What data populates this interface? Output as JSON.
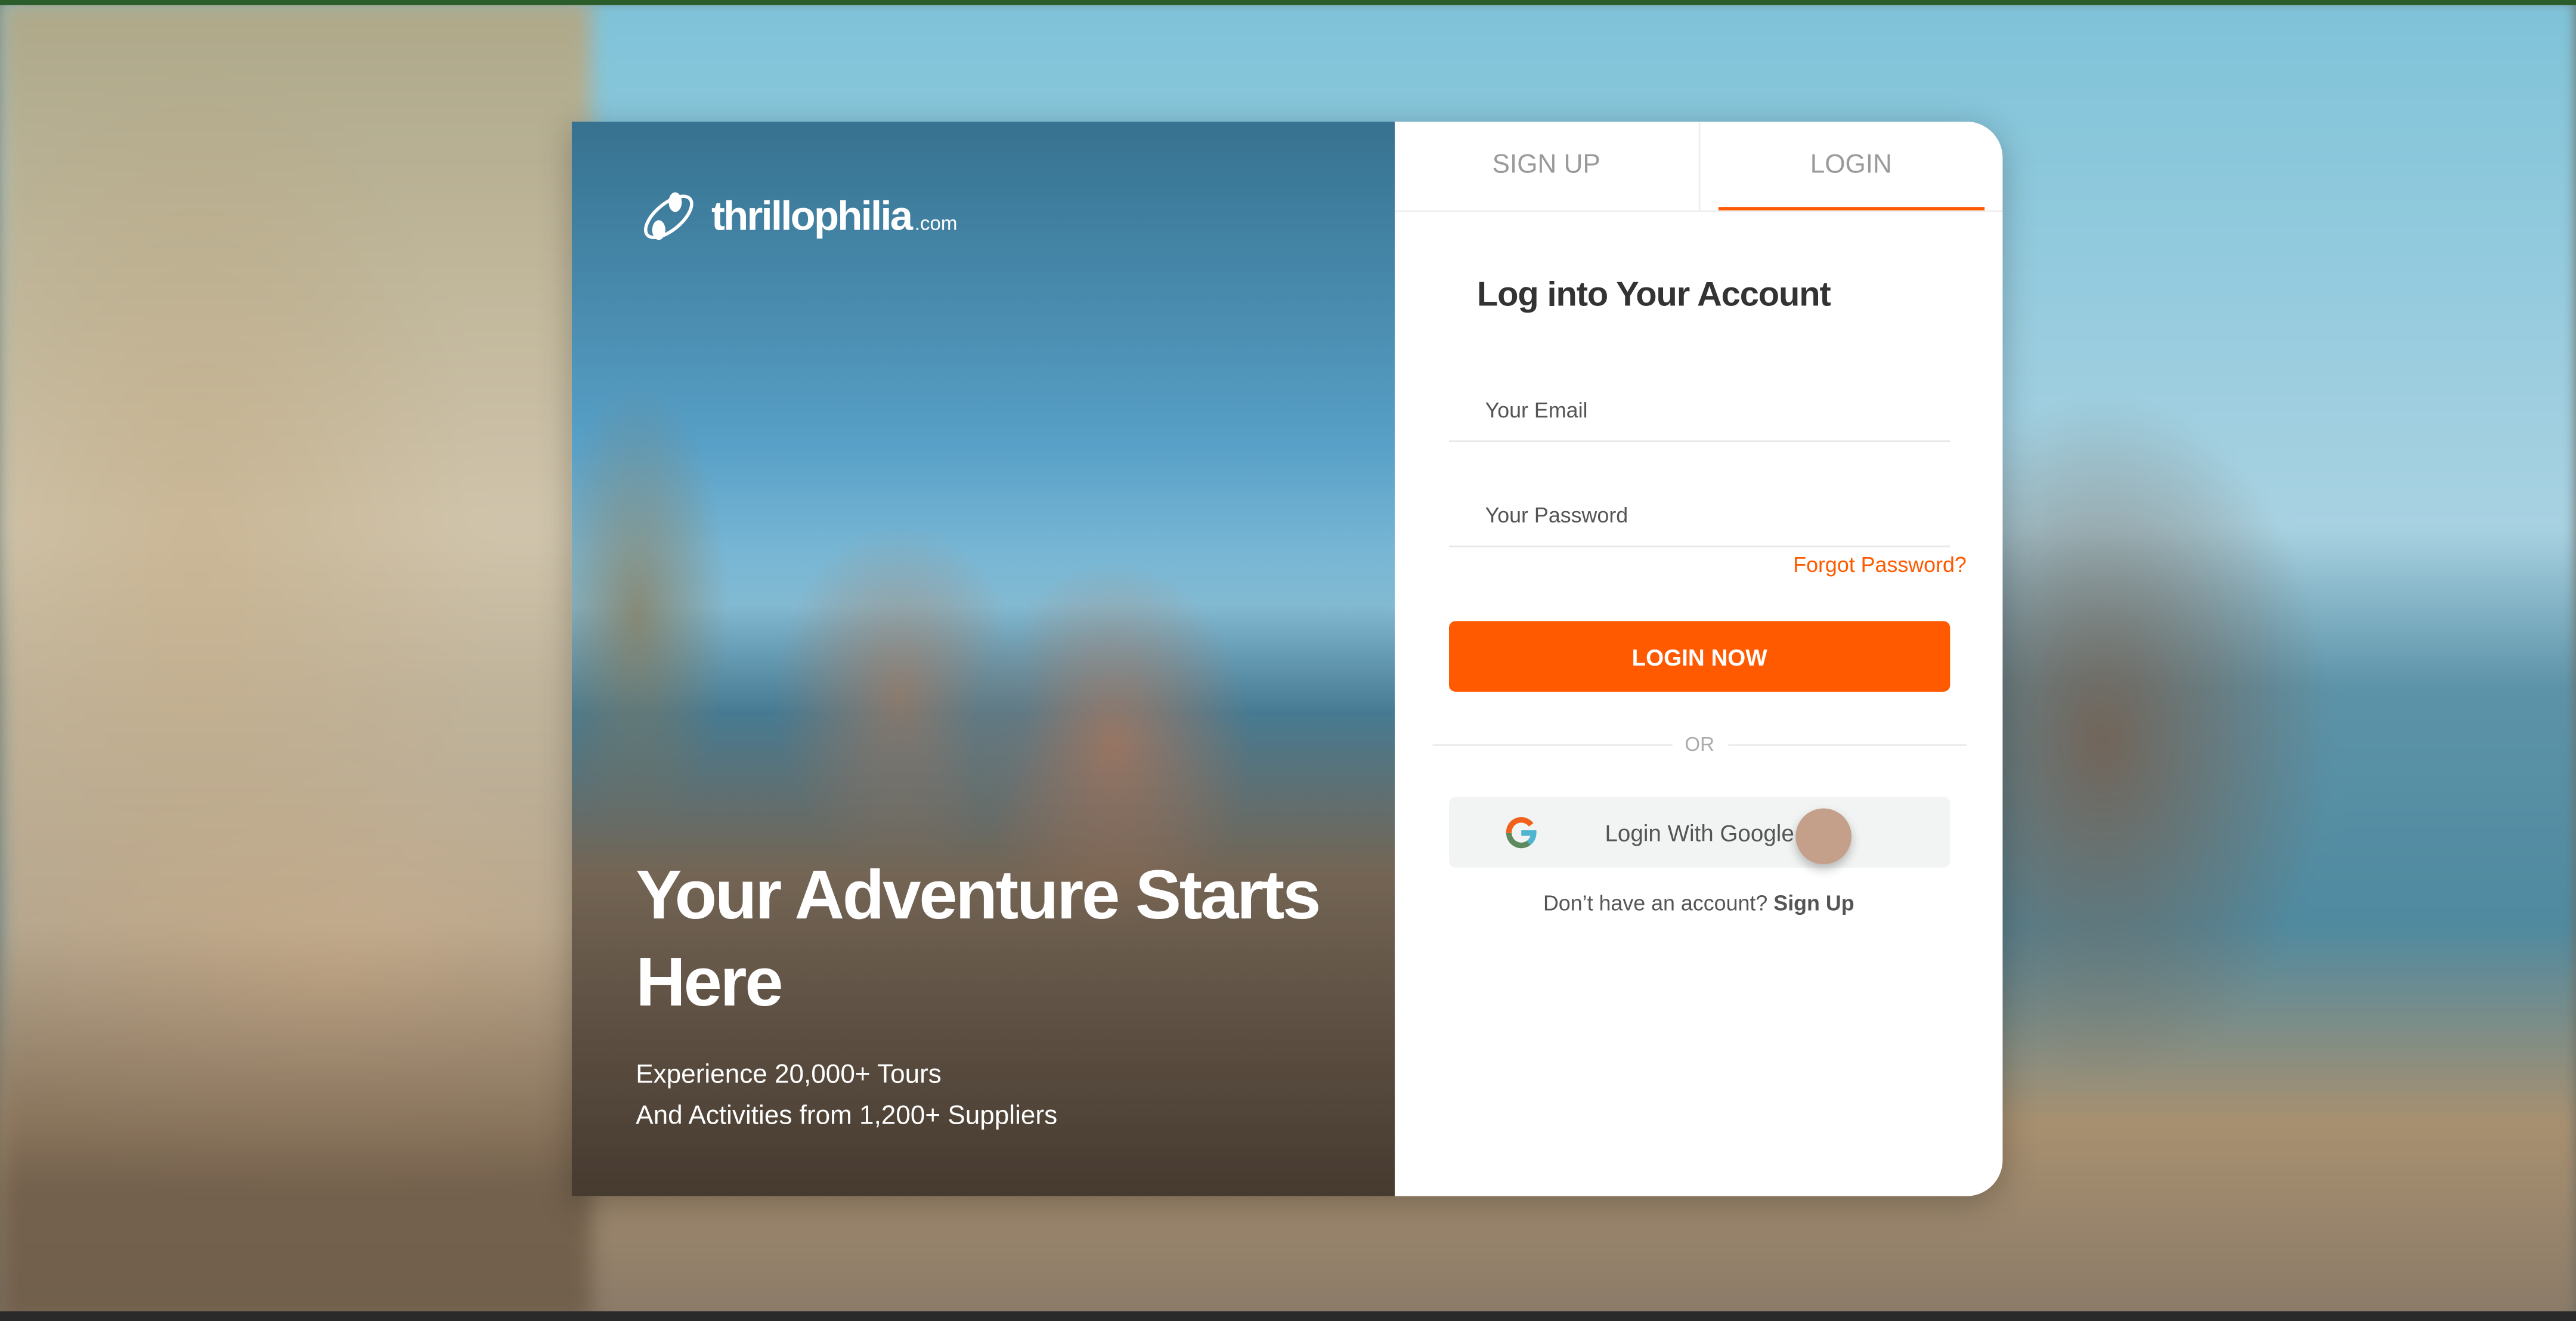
{
  "brand": {
    "name": "thrillophilia",
    "domain": ".com"
  },
  "hero": {
    "title": "Your Adventure Starts Here",
    "line1": "Experience 20,000+ Tours",
    "line2": "And Activities from 1,200+ Suppliers"
  },
  "tabs": [
    {
      "label": "SIGN UP",
      "active": false
    },
    {
      "label": "LOGIN",
      "active": true
    }
  ],
  "form": {
    "title": "Log into Your Account",
    "email_placeholder": "Your Email",
    "password_placeholder": "Your Password",
    "forgot": "Forgot Password?",
    "submit": "LOGIN NOW",
    "or": "OR",
    "google": "Login With Google",
    "no_account": "Don’t have an account?",
    "signup_link": "Sign Up"
  },
  "colors": {
    "accent": "#ff5a00",
    "google_button_bg": "#f2f4f4"
  }
}
